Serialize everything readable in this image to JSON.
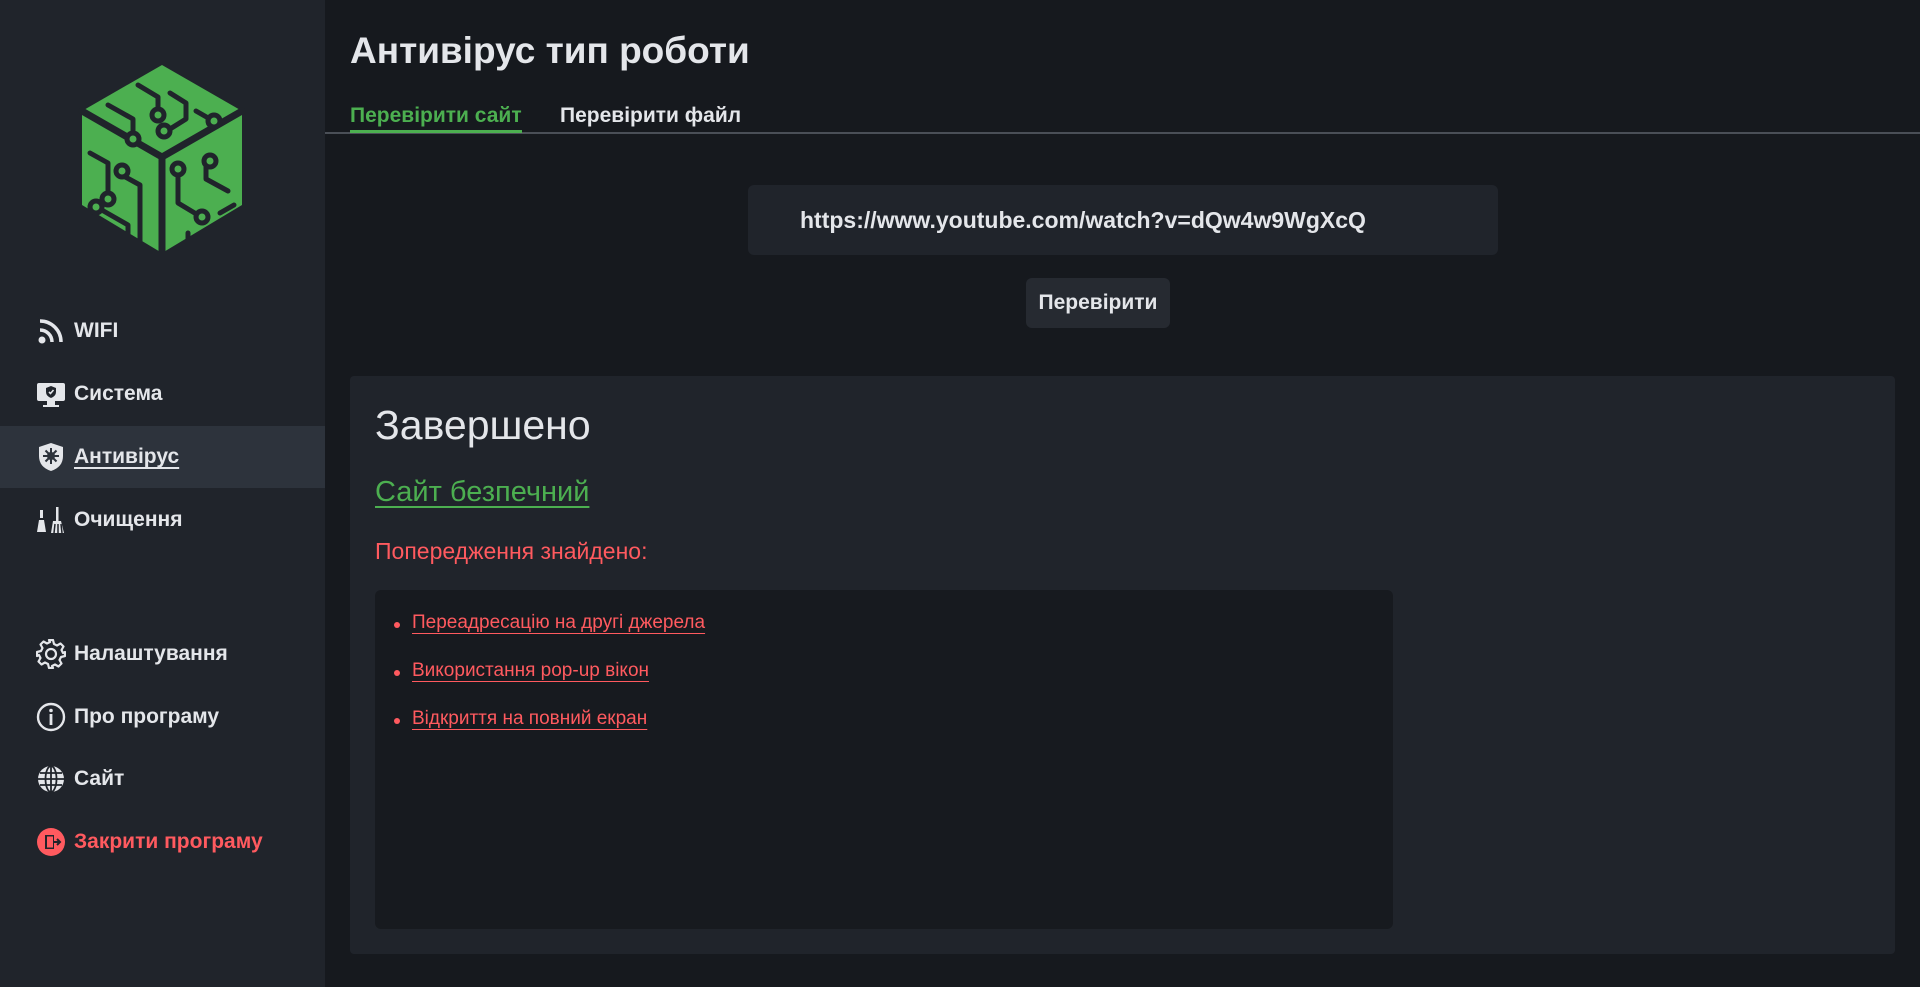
{
  "sidebar": {
    "logo": "circuit-cube-logo",
    "items": [
      {
        "label": "WIFI",
        "icon": "wifi-rss-icon"
      },
      {
        "label": "Система",
        "icon": "monitor-shield-icon"
      },
      {
        "label": "Антивірус",
        "icon": "shield-virus-icon",
        "active": true
      },
      {
        "label": "Очищення",
        "icon": "broom-icon"
      },
      {
        "label": "Налаштування",
        "icon": "gear-icon"
      },
      {
        "label": "Про програму",
        "icon": "info-icon"
      },
      {
        "label": "Сайт",
        "icon": "globe-icon"
      },
      {
        "label": "Закрити програму",
        "icon": "exit-door-icon"
      }
    ]
  },
  "header": {
    "title": "Антивірус тип роботи"
  },
  "tabs": [
    {
      "label": "Перевірити сайт",
      "active": true
    },
    {
      "label": "Перевірити файл",
      "active": false
    }
  ],
  "url_input": {
    "value": "https://www.youtube.com/watch?v=dQw4w9WgXcQ"
  },
  "check_button": {
    "label": "Перевірити"
  },
  "result": {
    "status": "Завершено",
    "verdict": "Сайт безпечний",
    "warnings_header": "Попередження знайдено:",
    "warnings": [
      "Переадресацію на другі джерела",
      "Використання pop-up вікон",
      "Відкриття на повний екран"
    ]
  },
  "colors": {
    "accent_green": "#4caf50",
    "danger_red": "#ff5a5f",
    "sidebar_bg": "#20242b",
    "main_bg": "#16191e"
  }
}
